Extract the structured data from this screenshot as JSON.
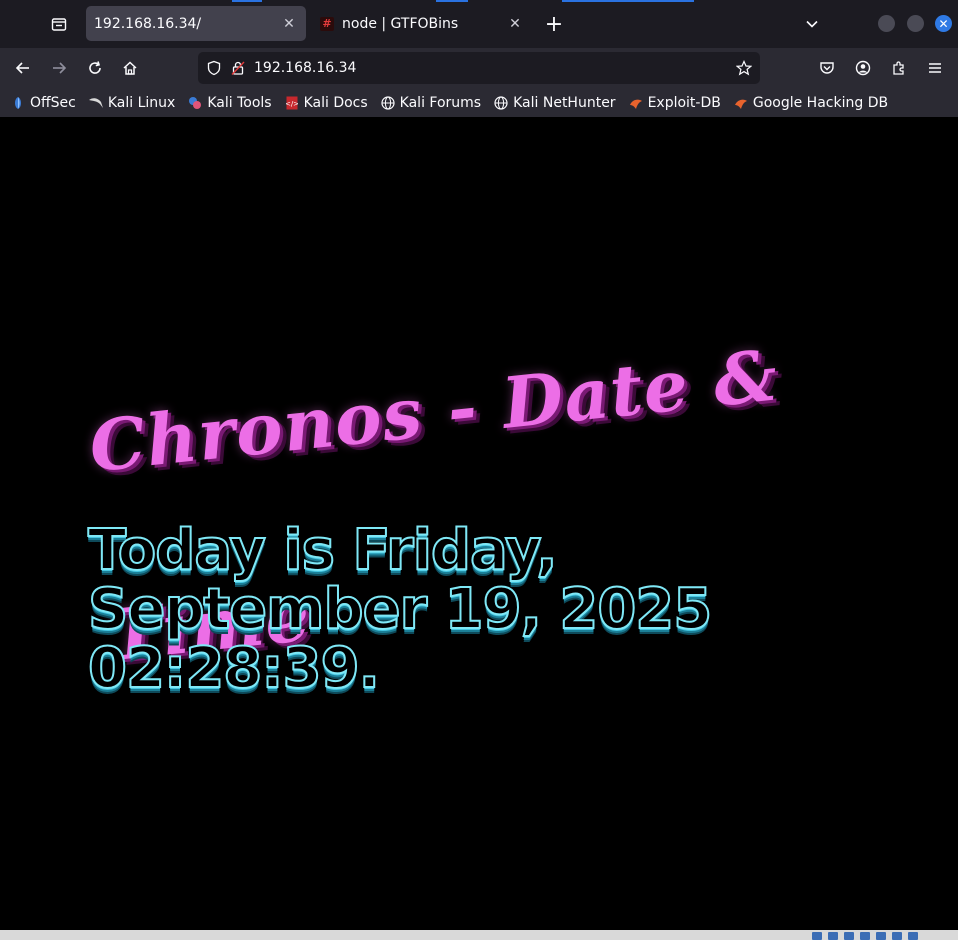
{
  "browser": {
    "tabs": [
      {
        "title": "192.168.16.34/",
        "active": true
      },
      {
        "title": "node | GTFOBins",
        "active": false
      }
    ],
    "new_tab_symbol": "+",
    "close_symbol": "✕",
    "url": "192.168.16.34",
    "accent_color": "#2f7ae5"
  },
  "bookmarks": [
    {
      "label": "OffSec",
      "icon": "offsec-icon"
    },
    {
      "label": "Kali Linux",
      "icon": "kali-dragon-icon"
    },
    {
      "label": "Kali Tools",
      "icon": "kali-tools-icon"
    },
    {
      "label": "Kali Docs",
      "icon": "kali-docs-icon"
    },
    {
      "label": "Kali Forums",
      "icon": "globe-icon"
    },
    {
      "label": "Kali NetHunter",
      "icon": "globe-icon"
    },
    {
      "label": "Exploit-DB",
      "icon": "exploitdb-icon"
    },
    {
      "label": "Google Hacking DB",
      "icon": "exploitdb-icon"
    }
  ],
  "page": {
    "title": "Chronos - Date & Time",
    "date_line": "Today is Friday, September 19, 2025 02:28:39.",
    "title_color": "#ec6ee6",
    "date_color": "#7fe8f6"
  }
}
